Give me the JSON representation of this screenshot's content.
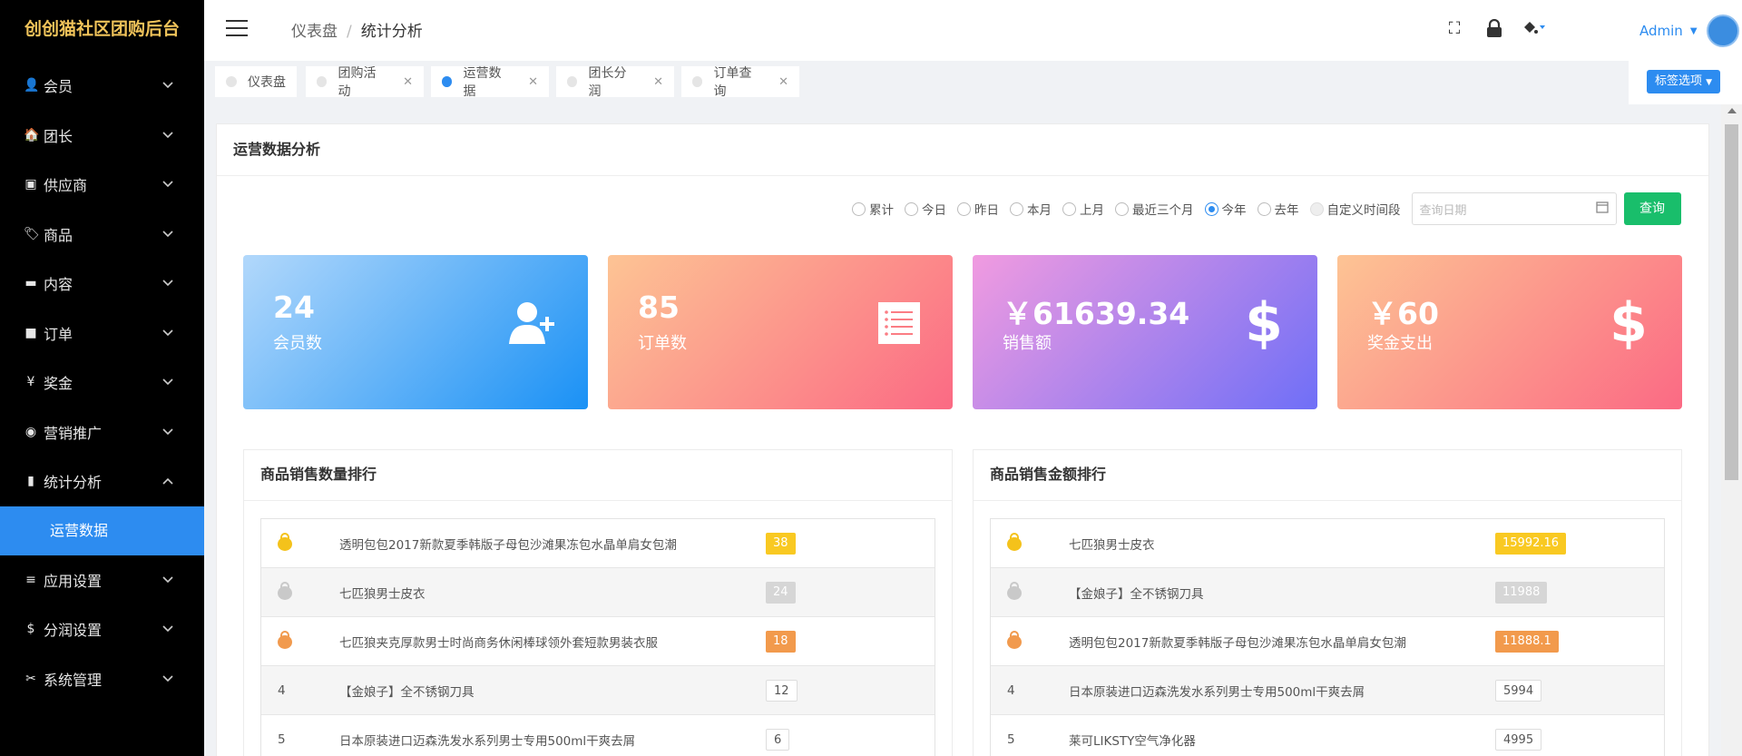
{
  "brand": "创创猫社区团购后台",
  "sidebar": {
    "items": [
      {
        "name": "members",
        "label": "会员",
        "icon": "👤"
      },
      {
        "name": "leaders",
        "label": "团长",
        "icon": "🏠"
      },
      {
        "name": "suppliers",
        "label": "供应商",
        "icon": "▣"
      },
      {
        "name": "products",
        "label": "商品",
        "icon": "🏷"
      },
      {
        "name": "content",
        "label": "内容",
        "icon": "▬"
      },
      {
        "name": "orders",
        "label": "订单",
        "icon": "■"
      },
      {
        "name": "bonus",
        "label": "奖金",
        "icon": "¥"
      },
      {
        "name": "marketing",
        "label": "营销推广",
        "icon": "◉"
      },
      {
        "name": "statistics",
        "label": "统计分析",
        "icon": "▮"
      },
      {
        "name": "app-settings",
        "label": "应用设置",
        "icon": "≡"
      },
      {
        "name": "profit-settings",
        "label": "分润设置",
        "icon": "$"
      },
      {
        "name": "system",
        "label": "系统管理",
        "icon": "✂"
      }
    ],
    "open_submenu": "运营数据"
  },
  "header": {
    "breadcrumb": [
      "仪表盘",
      "统计分析"
    ],
    "user": "Admin"
  },
  "tabs": [
    {
      "label": "仪表盘",
      "closable": false,
      "active": false
    },
    {
      "label": "团购活动",
      "closable": true,
      "active": false
    },
    {
      "label": "运营数据",
      "closable": true,
      "active": true
    },
    {
      "label": "团长分润",
      "closable": true,
      "active": false
    },
    {
      "label": "订单查询",
      "closable": true,
      "active": false
    }
  ],
  "tab_options_label": "标签选项",
  "panel": {
    "title": "运营数据分析",
    "filters": [
      "累计",
      "今日",
      "昨日",
      "本月",
      "上月",
      "最近三个月",
      "今年",
      "去年",
      "自定义时间段"
    ],
    "selected_filter": "今年",
    "date_placeholder": "查询日期",
    "query_label": "查询"
  },
  "cards": [
    {
      "value": "24",
      "label": "会员数"
    },
    {
      "value": "85",
      "label": "订单数"
    },
    {
      "value": "￥61639.34",
      "label": "销售额"
    },
    {
      "value": "￥60",
      "label": "奖金支出"
    }
  ],
  "quantity_ranking": {
    "title": "商品销售数量排行",
    "rows": [
      {
        "rank": "1",
        "name": "透明包包2017新款夏季韩版子母包沙滩果冻包水晶单肩女包潮",
        "value": "38"
      },
      {
        "rank": "2",
        "name": "七匹狼男士皮衣",
        "value": "24"
      },
      {
        "rank": "3",
        "name": "七匹狼夹克厚款男士时尚商务休闲棒球领外套短款男装衣服",
        "value": "18"
      },
      {
        "rank": "4",
        "name": "【金娘子】全不锈钢刀具",
        "value": "12"
      },
      {
        "rank": "5",
        "name": "日本原装进口迈森洗发水系列男士专用500ml干爽去屑",
        "value": "6"
      }
    ]
  },
  "amount_ranking": {
    "title": "商品销售金额排行",
    "rows": [
      {
        "rank": "1",
        "name": "七匹狼男士皮衣",
        "value": "15992.16"
      },
      {
        "rank": "2",
        "name": "【金娘子】全不锈钢刀具",
        "value": "11988"
      },
      {
        "rank": "3",
        "name": "透明包包2017新款夏季韩版子母包沙滩果冻包水晶单肩女包潮",
        "value": "11888.1"
      },
      {
        "rank": "4",
        "name": "日本原装进口迈森洗发水系列男士专用500ml干爽去屑",
        "value": "5994"
      },
      {
        "rank": "5",
        "name": "莱可LIKSTY空气净化器",
        "value": "4995"
      }
    ]
  },
  "colors": {
    "primary": "#2d8cf0",
    "success": "#19be6b",
    "brand_text": "#f0c35a",
    "gold": "#f9c922",
    "silver": "#d6d6d6",
    "bronze": "#f29a4c"
  }
}
